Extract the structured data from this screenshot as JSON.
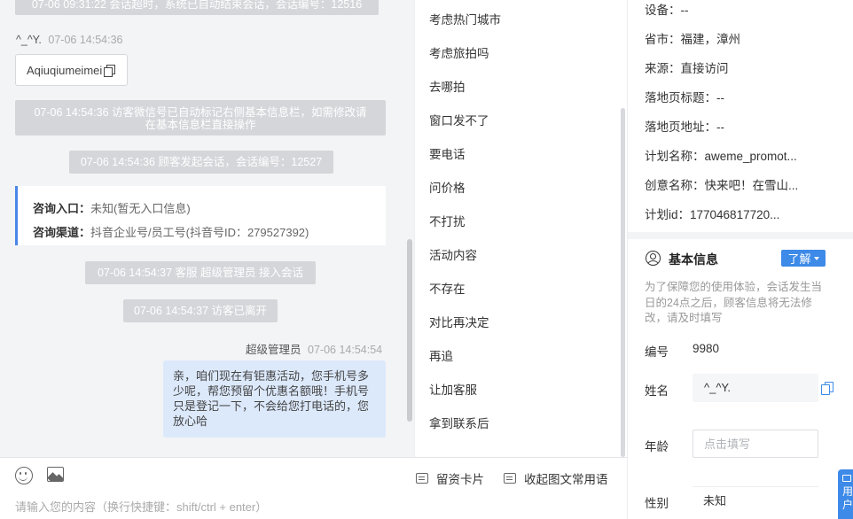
{
  "chat": {
    "sys1": "07-06 09:31:22 会话超时，系统已自动结束会话，会话编号：12516",
    "visitor_name": "^_^Y.",
    "visitor_time": "07-06 14:54:36",
    "copy_text": "Aqiuqiumeimei",
    "sys2_line1": "07-06 14:54:36 访客微信号已自动标记右侧基本信息栏，如需修改请",
    "sys2_line2": "在基本信息栏直接操作",
    "sys3": "07-06 14:54:36 顾客发起会话，会话编号：12527",
    "entry_label": "咨询入口：",
    "entry_value": "未知(暂无入口信息)",
    "channel_label": "咨询渠道：",
    "channel_value": "抖音企业号/员工号(抖音号ID：279527392)",
    "sys4": "07-06 14:54:37 客服 超级管理员 接入会话",
    "sys5": "07-06 14:54:37 访客已离开",
    "agent_name": "超级管理员",
    "agent_time": "07-06 14:54:54",
    "agent_line1": "亲，咱们现在有钜惠活动，您手机号多",
    "agent_line2": "少呢，帮您预留个优惠名额哦！手机号",
    "agent_line3": "只是登记一下，不会给您打电话的，您",
    "agent_line4": "放心哈"
  },
  "phrases": [
    "考虑热门城市",
    "考虑旅拍吗",
    "去哪拍",
    "窗口发不了",
    "要电话",
    "问价格",
    "不打扰",
    "活动内容",
    "不存在",
    "对比再决定",
    "再追",
    "让加客服",
    "拿到联系后"
  ],
  "input": {
    "card_label": "留资卡片",
    "fold_label": "收起图文常用语",
    "placeholder": "请输入您的内容（换行快捷键：shift/ctrl + enter）"
  },
  "right": {
    "device": "设备：--",
    "region": "省市：福建，漳州",
    "source": "来源：直接访问",
    "landing_title": "落地页标题：--",
    "landing_url": "落地页地址：--",
    "plan_name": "计划名称：aweme_promot...",
    "creative_name": "创意名称：快来吧！在雪山...",
    "plan_id": "计划id：177046817720...",
    "basic_title": "基本信息",
    "learn_label": "了解",
    "notice": "为了保障您的使用体验，会话发生当日的24点之后，顾客信息将无法修改，请及时填写",
    "id_label": "编号",
    "id_value": "9980",
    "name_label": "姓名",
    "name_value": "^_^Y.",
    "age_label": "年龄",
    "age_placeholder": "点击填写",
    "gender_label": "性别",
    "gender_value": "未知",
    "float_text": "用户"
  }
}
